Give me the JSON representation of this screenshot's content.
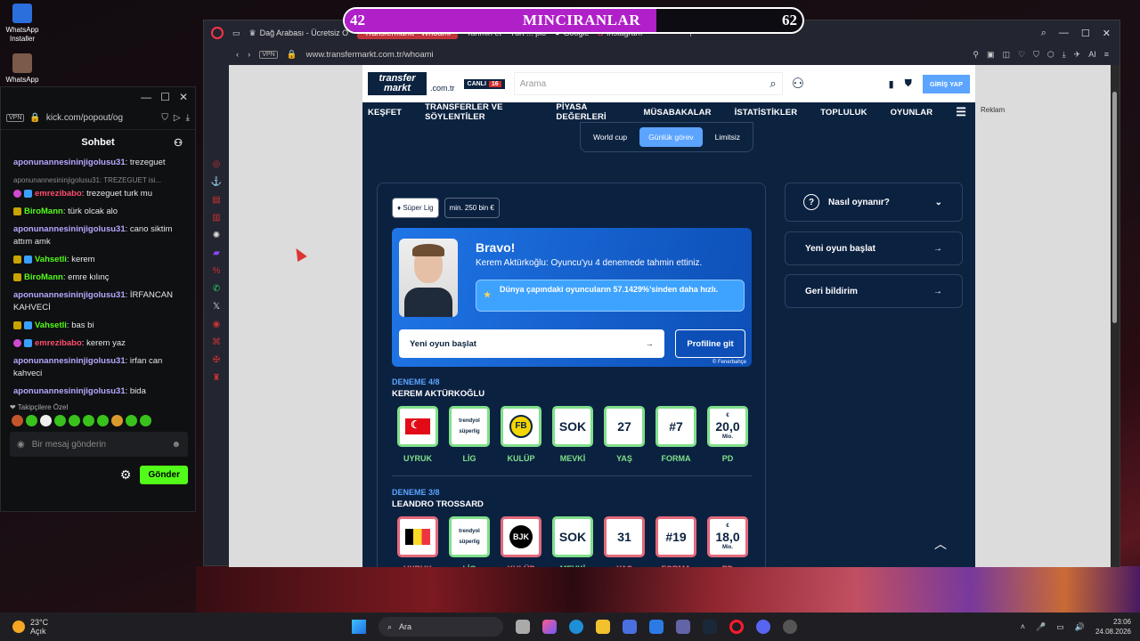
{
  "desktop": {
    "icons": [
      {
        "label": "WhatsApp Installer"
      },
      {
        "label": "WhatsApp"
      }
    ]
  },
  "overlay": {
    "left_value": "42",
    "title": "MINCIRANLAR",
    "right_value": "62",
    "fill_fraction": 0.68
  },
  "kick": {
    "url": "kick.com/popout/og",
    "vpn": "VPN",
    "header": "Sohbet",
    "messages": [
      {
        "user": "aponunannesininjigolusu31",
        "text": ": trezeguet",
        "color": "u1"
      },
      {
        "reply": "aponunannesininjigolusu31: TREZEGUET isi...",
        "user": "emrezibabo",
        "text": ": trezeguet turk mu",
        "color": "u2",
        "badges": [
          "pink",
          "vip"
        ]
      },
      {
        "user": "BiroMann",
        "text": ": türk olcak alo",
        "color": "u3",
        "badges": [
          "sub"
        ]
      },
      {
        "user": "aponunannesininjigolusu31",
        "text": ": cano siktim attım amk",
        "color": "u1"
      },
      {
        "user": "Vahsetli",
        "text": ": kerem",
        "color": "u3",
        "badges": [
          "sub",
          "vip"
        ]
      },
      {
        "user": "BiroMann",
        "text": ": emre kılınç",
        "color": "u3",
        "badges": [
          "sub"
        ]
      },
      {
        "user": "aponunannesininjigolusu31",
        "text": ": İRFANCAN KAHVECİ",
        "color": "u1"
      },
      {
        "user": "Vahsetli",
        "text": ": bas bi",
        "color": "u3",
        "badges": [
          "sub",
          "vip"
        ]
      },
      {
        "user": "emrezibabo",
        "text": ": kerem yaz",
        "color": "u2",
        "badges": [
          "pink",
          "vip"
        ]
      },
      {
        "user": "aponunannesininjigolusu31",
        "text": ": irfan can kahveci",
        "color": "u1"
      },
      {
        "user": "aponunannesininjigolusu31",
        "text": ": bida",
        "color": "u1"
      }
    ],
    "followers_label": "Takipçilere Özel",
    "input_placeholder": "Bir mesaj gönderin",
    "send_label": "Gönder"
  },
  "browser": {
    "tabs": [
      {
        "label": "Dağ Arabası - Ücretsiz O"
      },
      {
        "label": "Transfermarkt - Whoami"
      },
      {
        "label": "Tahmin et - 'Yurt ... plo"
      },
      {
        "label": "Google"
      },
      {
        "label": "Instagram"
      }
    ],
    "vpn": "VPN",
    "url": "www.transfermarkt.com.tr/whoami",
    "ai_label": "AI"
  },
  "tm": {
    "logo_top": "transfer",
    "logo_bottom": "markt",
    "domain": ".com.tr",
    "live_label": "CANLI",
    "live_count": "16",
    "search_placeholder": "Arama",
    "login_label": "GİRİŞ YAP",
    "nav": [
      "KEŞFET",
      "TRANSFERLER VE SÖYLENTİLER",
      "PİYASA DEĞERLERİ",
      "MÜSABAKALAR",
      "İSTATİSTİKLER",
      "TOPLULUK",
      "OYUNLAR"
    ],
    "game_tabs": [
      "World cup",
      "Günlük görev",
      "Limitsiz"
    ],
    "chip_league": "Süper Lig",
    "chip_value": "min. 250 bin €",
    "result": {
      "title": "Bravo!",
      "subtitle": "Kerem Aktürkoğlu: Oyuncu'yu 4 denemede tahmin ettiniz.",
      "stat": "Dünya çapındaki oyuncuların 57.1429%'sinden daha hızlı.",
      "new_game": "Yeni oyun başlat",
      "profile": "Profiline git",
      "copyright": "© Fenerbahçe"
    },
    "attempts": [
      {
        "label": "DENEME 4/8",
        "name": "KEREM AKTÜRKOĞLU",
        "position": "SOK",
        "age": "27",
        "shirt": "#7",
        "value": "20,0",
        "value_unit": "Mio.",
        "league_text": "trendyol süperlig",
        "club": "FB"
      },
      {
        "label": "DENEME 3/8",
        "name": "LEANDRO TROSSARD",
        "position": "SOK",
        "age": "31",
        "shirt": "#19",
        "value": "18,0",
        "value_unit": "Mio.",
        "league_text": "trendyol süperlig",
        "club": "BJK"
      }
    ],
    "tile_labels": [
      "UYRUK",
      "LİG",
      "KULÜP",
      "MEVKİ",
      "YAŞ",
      "FORMA",
      "PD"
    ],
    "currency": "€",
    "side": {
      "how": "Nasıl oynanır?",
      "new_game": "Yeni oyun başlat",
      "feedback": "Geri bildirim"
    },
    "ad_label": "Reklam"
  },
  "taskbar": {
    "temp": "23°C",
    "weather": "Açık",
    "search": "Ara",
    "time": "23:06",
    "date": "24.08.2026"
  }
}
